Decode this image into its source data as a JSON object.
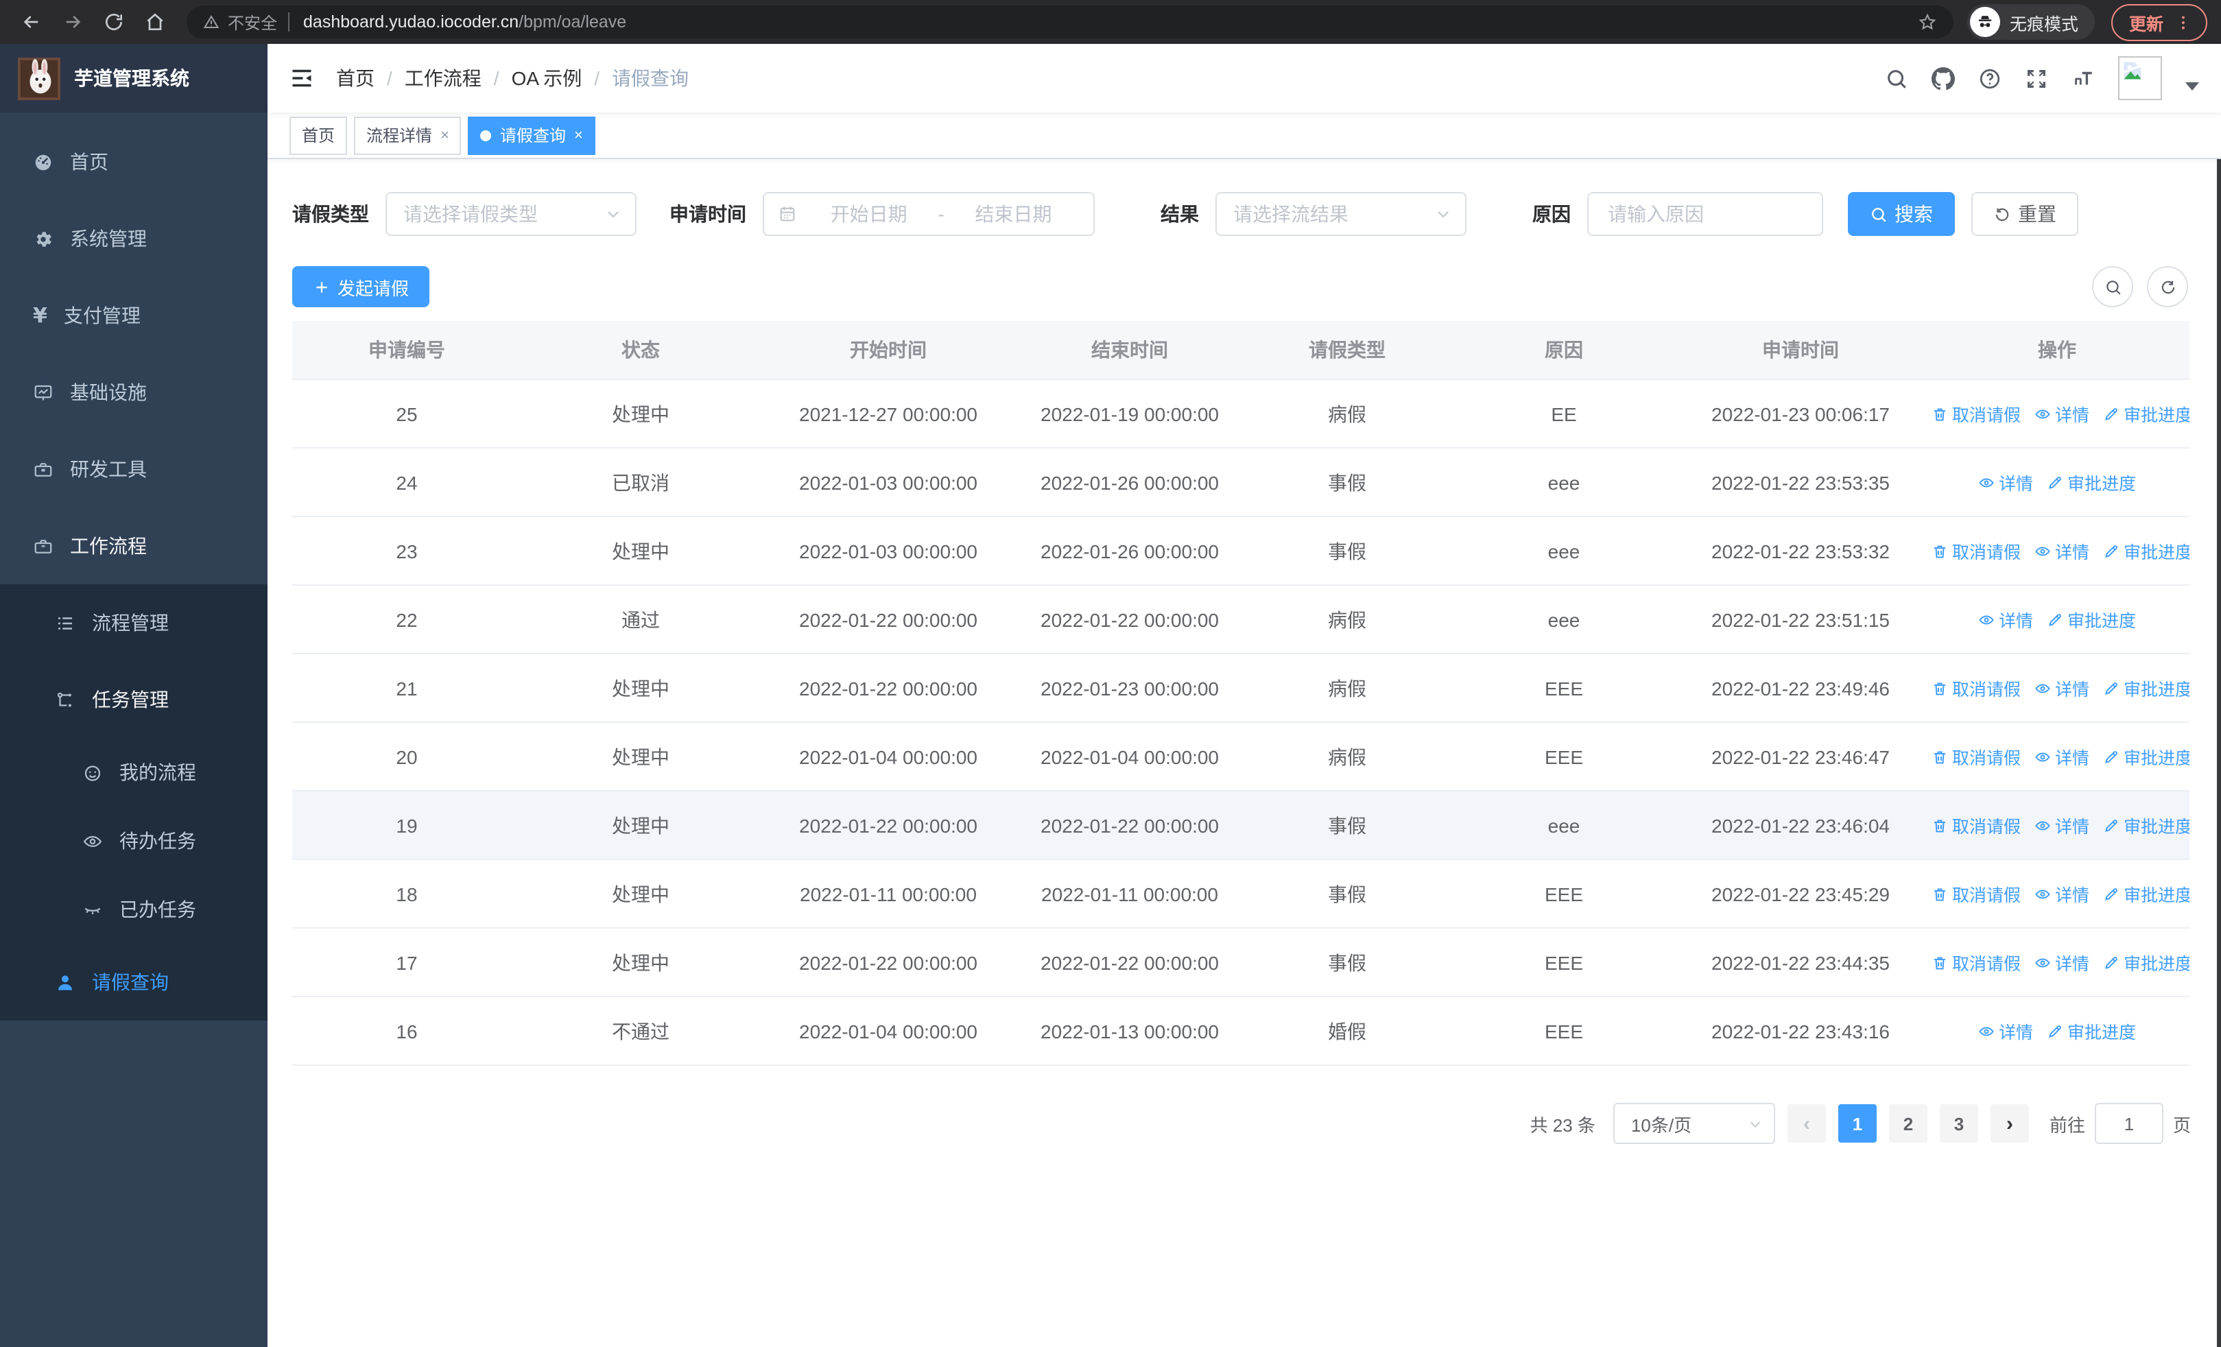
{
  "browser": {
    "security_label": "不安全",
    "url_host": "dashboard.yudao.iocoder.cn",
    "url_path": "/bpm/oa/leave",
    "incognito_label": "无痕模式",
    "update_label": "更新"
  },
  "sidebar": {
    "title": "芋道管理系统",
    "menu": [
      {
        "key": "home",
        "label": "首页",
        "icon": "dashboard-icon",
        "level": 1,
        "sub": false
      },
      {
        "key": "system",
        "label": "系统管理",
        "icon": "gear-icon",
        "level": 1,
        "sub": false,
        "arrow": "down"
      },
      {
        "key": "payment",
        "label": "支付管理",
        "icon": "yen-icon",
        "level": 1,
        "sub": false,
        "arrow": "down"
      },
      {
        "key": "infra",
        "label": "基础设施",
        "icon": "monitor-icon",
        "level": 1,
        "sub": false,
        "arrow": "down"
      },
      {
        "key": "devtools",
        "label": "研发工具",
        "icon": "toolbox-icon",
        "level": 1,
        "sub": false,
        "arrow": "down"
      },
      {
        "key": "workflow",
        "label": "工作流程",
        "icon": "briefcase-icon",
        "level": 1,
        "sub": false,
        "arrow": "up",
        "bright": true
      },
      {
        "key": "process-mgmt",
        "label": "流程管理",
        "icon": "list-icon",
        "level": 2,
        "sub": true,
        "arrow": "down"
      },
      {
        "key": "task-mgmt",
        "label": "任务管理",
        "icon": "flow-icon",
        "level": 2,
        "sub": true,
        "arrow": "up",
        "bright": true
      },
      {
        "key": "my-process",
        "label": "我的流程",
        "icon": "face-icon",
        "level": 3,
        "sub": true
      },
      {
        "key": "todo-tasks",
        "label": "待办任务",
        "icon": "eye-icon",
        "level": 3,
        "sub": true
      },
      {
        "key": "done-tasks",
        "label": "已办任务",
        "icon": "eye-closed-icon",
        "level": 3,
        "sub": true
      },
      {
        "key": "leave-query",
        "label": "请假查询",
        "icon": "user-icon",
        "level": 2,
        "sub": true,
        "active": true
      }
    ]
  },
  "breadcrumb": [
    "首页",
    "工作流程",
    "OA 示例",
    "请假查询"
  ],
  "tabs": [
    {
      "key": "home",
      "label": "首页",
      "closable": false,
      "active": false
    },
    {
      "key": "process-detail",
      "label": "流程详情",
      "closable": true,
      "active": false
    },
    {
      "key": "leave-query",
      "label": "请假查询",
      "closable": true,
      "active": true
    }
  ],
  "filters": {
    "leave_type": {
      "label": "请假类型",
      "placeholder": "请选择请假类型"
    },
    "apply_time": {
      "label": "申请时间",
      "start_placeholder": "开始日期",
      "separator": "-",
      "end_placeholder": "结束日期"
    },
    "result": {
      "label": "结果",
      "placeholder": "请选择流结果"
    },
    "reason": {
      "label": "原因",
      "placeholder": "请输入原因"
    },
    "search_label": "搜索",
    "reset_label": "重置"
  },
  "toolbar": {
    "create_label": "发起请假"
  },
  "table": {
    "columns": [
      "申请编号",
      "状态",
      "开始时间",
      "结束时间",
      "请假类型",
      "原因",
      "申请时间",
      "操作"
    ],
    "action_labels": {
      "cancel": "取消请假",
      "detail": "详情",
      "progress": "审批进度"
    },
    "rows": [
      {
        "id": "25",
        "status": "处理中",
        "start": "2021-12-27 00:00:00",
        "end": "2022-01-19 00:00:00",
        "type": "病假",
        "reason": "EE",
        "apply": "2022-01-23 00:06:17",
        "actions": [
          "cancel",
          "detail",
          "progress"
        ],
        "highlighted": false
      },
      {
        "id": "24",
        "status": "已取消",
        "start": "2022-01-03 00:00:00",
        "end": "2022-01-26 00:00:00",
        "type": "事假",
        "reason": "eee",
        "apply": "2022-01-22 23:53:35",
        "actions": [
          "detail",
          "progress"
        ],
        "highlighted": false
      },
      {
        "id": "23",
        "status": "处理中",
        "start": "2022-01-03 00:00:00",
        "end": "2022-01-26 00:00:00",
        "type": "事假",
        "reason": "eee",
        "apply": "2022-01-22 23:53:32",
        "actions": [
          "cancel",
          "detail",
          "progress"
        ],
        "highlighted": false
      },
      {
        "id": "22",
        "status": "通过",
        "start": "2022-01-22 00:00:00",
        "end": "2022-01-22 00:00:00",
        "type": "病假",
        "reason": "eee",
        "apply": "2022-01-22 23:51:15",
        "actions": [
          "detail",
          "progress"
        ],
        "highlighted": false
      },
      {
        "id": "21",
        "status": "处理中",
        "start": "2022-01-22 00:00:00",
        "end": "2022-01-23 00:00:00",
        "type": "病假",
        "reason": "EEE",
        "apply": "2022-01-22 23:49:46",
        "actions": [
          "cancel",
          "detail",
          "progress"
        ],
        "highlighted": false
      },
      {
        "id": "20",
        "status": "处理中",
        "start": "2022-01-04 00:00:00",
        "end": "2022-01-04 00:00:00",
        "type": "病假",
        "reason": "EEE",
        "apply": "2022-01-22 23:46:47",
        "actions": [
          "cancel",
          "detail",
          "progress"
        ],
        "highlighted": false
      },
      {
        "id": "19",
        "status": "处理中",
        "start": "2022-01-22 00:00:00",
        "end": "2022-01-22 00:00:00",
        "type": "事假",
        "reason": "eee",
        "apply": "2022-01-22 23:46:04",
        "actions": [
          "cancel",
          "detail",
          "progress"
        ],
        "highlighted": true
      },
      {
        "id": "18",
        "status": "处理中",
        "start": "2022-01-11 00:00:00",
        "end": "2022-01-11 00:00:00",
        "type": "事假",
        "reason": "EEE",
        "apply": "2022-01-22 23:45:29",
        "actions": [
          "cancel",
          "detail",
          "progress"
        ],
        "highlighted": false
      },
      {
        "id": "17",
        "status": "处理中",
        "start": "2022-01-22 00:00:00",
        "end": "2022-01-22 00:00:00",
        "type": "事假",
        "reason": "EEE",
        "apply": "2022-01-22 23:44:35",
        "actions": [
          "cancel",
          "detail",
          "progress"
        ],
        "highlighted": false
      },
      {
        "id": "16",
        "status": "不通过",
        "start": "2022-01-04 00:00:00",
        "end": "2022-01-13 00:00:00",
        "type": "婚假",
        "reason": "EEE",
        "apply": "2022-01-22 23:43:16",
        "actions": [
          "detail",
          "progress"
        ],
        "highlighted": false
      }
    ]
  },
  "pagination": {
    "total_label": "共 23 条",
    "page_size_label": "10条/页",
    "pages": [
      "1",
      "2",
      "3"
    ],
    "active_page": "1",
    "prev_enabled": false,
    "next_enabled": true,
    "goto_label": "前往",
    "goto_value": "1",
    "unit_label": "页"
  },
  "colors": {
    "primary": "#409eff",
    "sidebar_bg": "#304156",
    "submenu_bg": "#1f2d3d",
    "update_accent": "#f28b82"
  }
}
